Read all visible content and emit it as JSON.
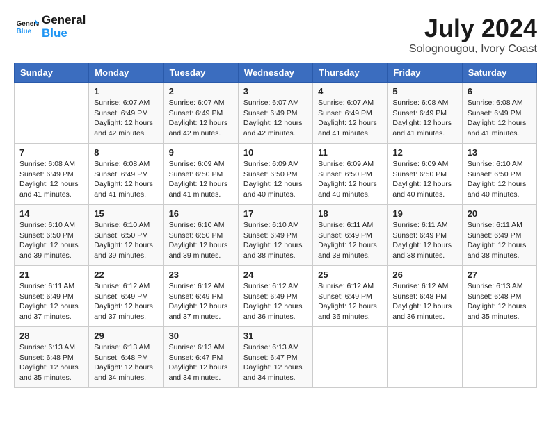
{
  "header": {
    "logo_line1": "General",
    "logo_line2": "Blue",
    "month": "July 2024",
    "location": "Solognougou, Ivory Coast"
  },
  "days_of_week": [
    "Sunday",
    "Monday",
    "Tuesday",
    "Wednesday",
    "Thursday",
    "Friday",
    "Saturday"
  ],
  "weeks": [
    [
      {
        "day": "",
        "info": ""
      },
      {
        "day": "1",
        "info": "Sunrise: 6:07 AM\nSunset: 6:49 PM\nDaylight: 12 hours\nand 42 minutes."
      },
      {
        "day": "2",
        "info": "Sunrise: 6:07 AM\nSunset: 6:49 PM\nDaylight: 12 hours\nand 42 minutes."
      },
      {
        "day": "3",
        "info": "Sunrise: 6:07 AM\nSunset: 6:49 PM\nDaylight: 12 hours\nand 42 minutes."
      },
      {
        "day": "4",
        "info": "Sunrise: 6:07 AM\nSunset: 6:49 PM\nDaylight: 12 hours\nand 41 minutes."
      },
      {
        "day": "5",
        "info": "Sunrise: 6:08 AM\nSunset: 6:49 PM\nDaylight: 12 hours\nand 41 minutes."
      },
      {
        "day": "6",
        "info": "Sunrise: 6:08 AM\nSunset: 6:49 PM\nDaylight: 12 hours\nand 41 minutes."
      }
    ],
    [
      {
        "day": "7",
        "info": "Sunrise: 6:08 AM\nSunset: 6:49 PM\nDaylight: 12 hours\nand 41 minutes."
      },
      {
        "day": "8",
        "info": "Sunrise: 6:08 AM\nSunset: 6:49 PM\nDaylight: 12 hours\nand 41 minutes."
      },
      {
        "day": "9",
        "info": "Sunrise: 6:09 AM\nSunset: 6:50 PM\nDaylight: 12 hours\nand 41 minutes."
      },
      {
        "day": "10",
        "info": "Sunrise: 6:09 AM\nSunset: 6:50 PM\nDaylight: 12 hours\nand 40 minutes."
      },
      {
        "day": "11",
        "info": "Sunrise: 6:09 AM\nSunset: 6:50 PM\nDaylight: 12 hours\nand 40 minutes."
      },
      {
        "day": "12",
        "info": "Sunrise: 6:09 AM\nSunset: 6:50 PM\nDaylight: 12 hours\nand 40 minutes."
      },
      {
        "day": "13",
        "info": "Sunrise: 6:10 AM\nSunset: 6:50 PM\nDaylight: 12 hours\nand 40 minutes."
      }
    ],
    [
      {
        "day": "14",
        "info": "Sunrise: 6:10 AM\nSunset: 6:50 PM\nDaylight: 12 hours\nand 39 minutes."
      },
      {
        "day": "15",
        "info": "Sunrise: 6:10 AM\nSunset: 6:50 PM\nDaylight: 12 hours\nand 39 minutes."
      },
      {
        "day": "16",
        "info": "Sunrise: 6:10 AM\nSunset: 6:50 PM\nDaylight: 12 hours\nand 39 minutes."
      },
      {
        "day": "17",
        "info": "Sunrise: 6:10 AM\nSunset: 6:49 PM\nDaylight: 12 hours\nand 38 minutes."
      },
      {
        "day": "18",
        "info": "Sunrise: 6:11 AM\nSunset: 6:49 PM\nDaylight: 12 hours\nand 38 minutes."
      },
      {
        "day": "19",
        "info": "Sunrise: 6:11 AM\nSunset: 6:49 PM\nDaylight: 12 hours\nand 38 minutes."
      },
      {
        "day": "20",
        "info": "Sunrise: 6:11 AM\nSunset: 6:49 PM\nDaylight: 12 hours\nand 38 minutes."
      }
    ],
    [
      {
        "day": "21",
        "info": "Sunrise: 6:11 AM\nSunset: 6:49 PM\nDaylight: 12 hours\nand 37 minutes."
      },
      {
        "day": "22",
        "info": "Sunrise: 6:12 AM\nSunset: 6:49 PM\nDaylight: 12 hours\nand 37 minutes."
      },
      {
        "day": "23",
        "info": "Sunrise: 6:12 AM\nSunset: 6:49 PM\nDaylight: 12 hours\nand 37 minutes."
      },
      {
        "day": "24",
        "info": "Sunrise: 6:12 AM\nSunset: 6:49 PM\nDaylight: 12 hours\nand 36 minutes."
      },
      {
        "day": "25",
        "info": "Sunrise: 6:12 AM\nSunset: 6:49 PM\nDaylight: 12 hours\nand 36 minutes."
      },
      {
        "day": "26",
        "info": "Sunrise: 6:12 AM\nSunset: 6:48 PM\nDaylight: 12 hours\nand 36 minutes."
      },
      {
        "day": "27",
        "info": "Sunrise: 6:13 AM\nSunset: 6:48 PM\nDaylight: 12 hours\nand 35 minutes."
      }
    ],
    [
      {
        "day": "28",
        "info": "Sunrise: 6:13 AM\nSunset: 6:48 PM\nDaylight: 12 hours\nand 35 minutes."
      },
      {
        "day": "29",
        "info": "Sunrise: 6:13 AM\nSunset: 6:48 PM\nDaylight: 12 hours\nand 34 minutes."
      },
      {
        "day": "30",
        "info": "Sunrise: 6:13 AM\nSunset: 6:47 PM\nDaylight: 12 hours\nand 34 minutes."
      },
      {
        "day": "31",
        "info": "Sunrise: 6:13 AM\nSunset: 6:47 PM\nDaylight: 12 hours\nand 34 minutes."
      },
      {
        "day": "",
        "info": ""
      },
      {
        "day": "",
        "info": ""
      },
      {
        "day": "",
        "info": ""
      }
    ]
  ]
}
